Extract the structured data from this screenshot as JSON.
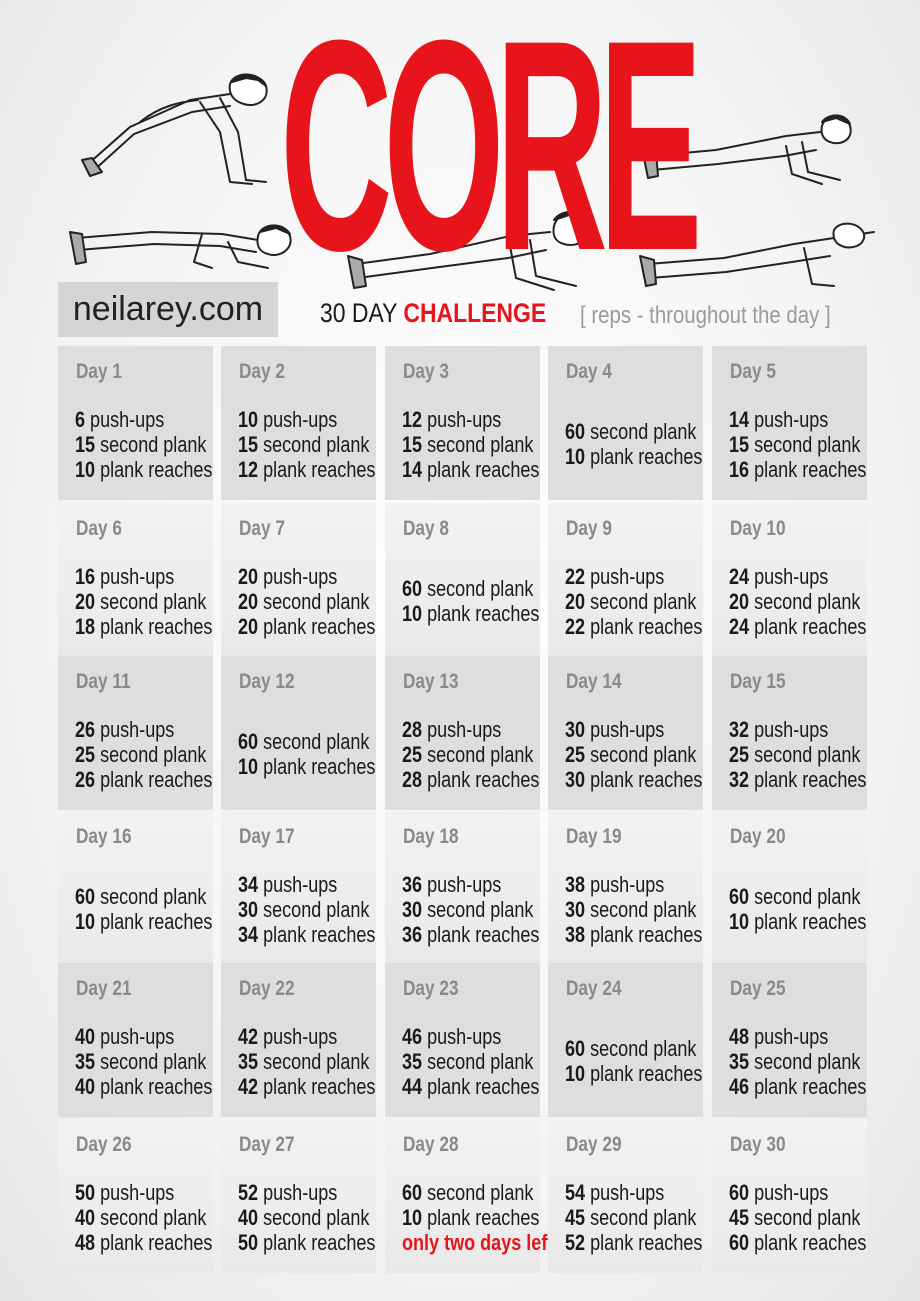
{
  "header": {
    "title": "CORE",
    "site": "neilarey.com",
    "challenge_prefix": "30 DAY",
    "challenge_highlight": "CHALLENGE",
    "subtitle": "[ reps - throughout the day ]",
    "accent_color": "#e8141b"
  },
  "illustrations": [
    "push-up-high-figure",
    "push-up-low-figure",
    "forearm-plank-figure",
    "forearm-plank-figure-right",
    "plank-reach-figure"
  ],
  "days": [
    {
      "label": "Day 1",
      "lines": [
        [
          "6",
          "push-ups"
        ],
        [
          "15",
          "second plank"
        ],
        [
          "10",
          "plank reaches"
        ]
      ]
    },
    {
      "label": "Day 2",
      "lines": [
        [
          "10",
          "push-ups"
        ],
        [
          "15",
          "second plank"
        ],
        [
          "12",
          "plank reaches"
        ]
      ]
    },
    {
      "label": "Day 3",
      "lines": [
        [
          "12",
          "push-ups"
        ],
        [
          "15",
          "second plank"
        ],
        [
          "14",
          "plank reaches"
        ]
      ]
    },
    {
      "label": "Day 4",
      "lines": [
        [
          "60",
          "second plank"
        ],
        [
          "10",
          "plank reaches"
        ]
      ]
    },
    {
      "label": "Day 5",
      "lines": [
        [
          "14",
          "push-ups"
        ],
        [
          "15",
          "second plank"
        ],
        [
          "16",
          "plank reaches"
        ]
      ]
    },
    {
      "label": "Day 6",
      "lines": [
        [
          "16",
          "push-ups"
        ],
        [
          "20",
          "second plank"
        ],
        [
          "18",
          "plank reaches"
        ]
      ]
    },
    {
      "label": "Day 7",
      "lines": [
        [
          "20",
          "push-ups"
        ],
        [
          "20",
          "second plank"
        ],
        [
          "20",
          "plank reaches"
        ]
      ]
    },
    {
      "label": "Day 8",
      "lines": [
        [
          "60",
          "second plank"
        ],
        [
          "10",
          "plank reaches"
        ]
      ]
    },
    {
      "label": "Day 9",
      "lines": [
        [
          "22",
          "push-ups"
        ],
        [
          "20",
          "second plank"
        ],
        [
          "22",
          "plank reaches"
        ]
      ]
    },
    {
      "label": "Day 10",
      "lines": [
        [
          "24",
          "push-ups"
        ],
        [
          "20",
          "second plank"
        ],
        [
          "24",
          "plank reaches"
        ]
      ]
    },
    {
      "label": "Day 11",
      "lines": [
        [
          "26",
          "push-ups"
        ],
        [
          "25",
          "second plank"
        ],
        [
          "26",
          "plank reaches"
        ]
      ]
    },
    {
      "label": "Day 12",
      "lines": [
        [
          "60",
          "second plank"
        ],
        [
          "10",
          "plank reaches"
        ]
      ]
    },
    {
      "label": "Day 13",
      "lines": [
        [
          "28",
          "push-ups"
        ],
        [
          "25",
          "second plank"
        ],
        [
          "28",
          "plank reaches"
        ]
      ]
    },
    {
      "label": "Day 14",
      "lines": [
        [
          "30",
          "push-ups"
        ],
        [
          "25",
          "second plank"
        ],
        [
          "30",
          "plank reaches"
        ]
      ]
    },
    {
      "label": "Day 15",
      "lines": [
        [
          "32",
          "push-ups"
        ],
        [
          "25",
          "second plank"
        ],
        [
          "32",
          "plank reaches"
        ]
      ]
    },
    {
      "label": "Day 16",
      "lines": [
        [
          "60",
          "second plank"
        ],
        [
          "10",
          "plank reaches"
        ]
      ]
    },
    {
      "label": "Day 17",
      "lines": [
        [
          "34",
          "push-ups"
        ],
        [
          "30",
          "second plank"
        ],
        [
          "34",
          "plank reaches"
        ]
      ]
    },
    {
      "label": "Day 18",
      "lines": [
        [
          "36",
          "push-ups"
        ],
        [
          "30",
          "second plank"
        ],
        [
          "36",
          "plank reaches"
        ]
      ]
    },
    {
      "label": "Day 19",
      "lines": [
        [
          "38",
          "push-ups"
        ],
        [
          "30",
          "second plank"
        ],
        [
          "38",
          "plank reaches"
        ]
      ]
    },
    {
      "label": "Day 20",
      "lines": [
        [
          "60",
          "second plank"
        ],
        [
          "10",
          "plank reaches"
        ]
      ]
    },
    {
      "label": "Day 21",
      "lines": [
        [
          "40",
          "push-ups"
        ],
        [
          "35",
          "second plank"
        ],
        [
          "40",
          "plank reaches"
        ]
      ]
    },
    {
      "label": "Day 22",
      "lines": [
        [
          "42",
          "push-ups"
        ],
        [
          "35",
          "second plank"
        ],
        [
          "42",
          "plank reaches"
        ]
      ]
    },
    {
      "label": "Day 23",
      "lines": [
        [
          "46",
          "push-ups"
        ],
        [
          "35",
          "second plank"
        ],
        [
          "44",
          "plank reaches"
        ]
      ]
    },
    {
      "label": "Day 24",
      "lines": [
        [
          "60",
          "second plank"
        ],
        [
          "10",
          "plank reaches"
        ]
      ]
    },
    {
      "label": "Day 25",
      "lines": [
        [
          "48",
          "push-ups"
        ],
        [
          "35",
          "second plank"
        ],
        [
          "46",
          "plank reaches"
        ]
      ]
    },
    {
      "label": "Day 26",
      "lines": [
        [
          "50",
          "push-ups"
        ],
        [
          "40",
          "second plank"
        ],
        [
          "48",
          "plank reaches"
        ]
      ]
    },
    {
      "label": "Day 27",
      "lines": [
        [
          "52",
          "push-ups"
        ],
        [
          "40",
          "second plank"
        ],
        [
          "50",
          "plank reaches"
        ]
      ]
    },
    {
      "label": "Day 28",
      "lines": [
        [
          "60",
          "second plank"
        ],
        [
          "10",
          "plank reaches"
        ]
      ],
      "note": "only two days left!"
    },
    {
      "label": "Day 29",
      "lines": [
        [
          "54",
          "push-ups"
        ],
        [
          "45",
          "second plank"
        ],
        [
          "52",
          "plank reaches"
        ]
      ]
    },
    {
      "label": "Day 30",
      "lines": [
        [
          "60",
          "push-ups"
        ],
        [
          "45",
          "second plank"
        ],
        [
          "60",
          "plank reaches"
        ]
      ]
    }
  ]
}
